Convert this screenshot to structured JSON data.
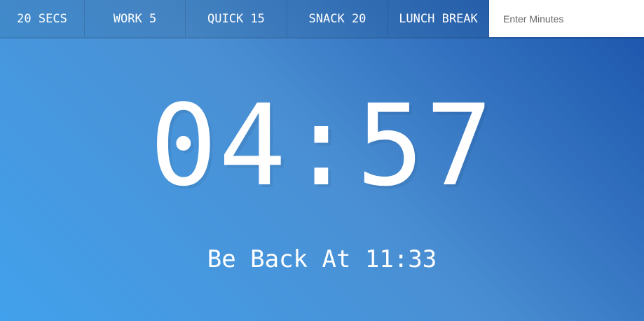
{
  "controls": {
    "buttons": [
      {
        "label": "20 SECS"
      },
      {
        "label": "WORK 5"
      },
      {
        "label": "QUICK 15"
      },
      {
        "label": "SNACK 20"
      },
      {
        "label": "LUNCH BREAK"
      }
    ],
    "input_placeholder": "Enter Minutes",
    "input_value": ""
  },
  "display": {
    "time_left": "04:57",
    "end_time": "Be Back At 11:33"
  },
  "colors": {
    "gradient_light": "#42a1ec",
    "gradient_dark": "#1a53ab",
    "text": "#ffffff"
  }
}
